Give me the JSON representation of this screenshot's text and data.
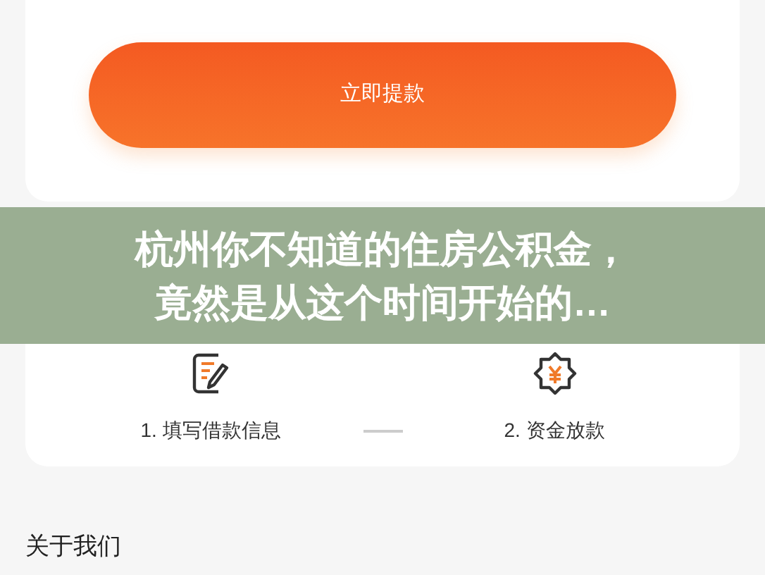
{
  "withdraw_button": {
    "label": "立即提款"
  },
  "steps": [
    {
      "kind": "form",
      "label": "1. 填写借款信息"
    },
    {
      "kind": "payout",
      "label": "2. 资金放款"
    }
  ],
  "about": {
    "title": "关于我们"
  },
  "banner": {
    "title": "杭州你不知道的住房公积金，竟然是从这个时间开始的…"
  }
}
